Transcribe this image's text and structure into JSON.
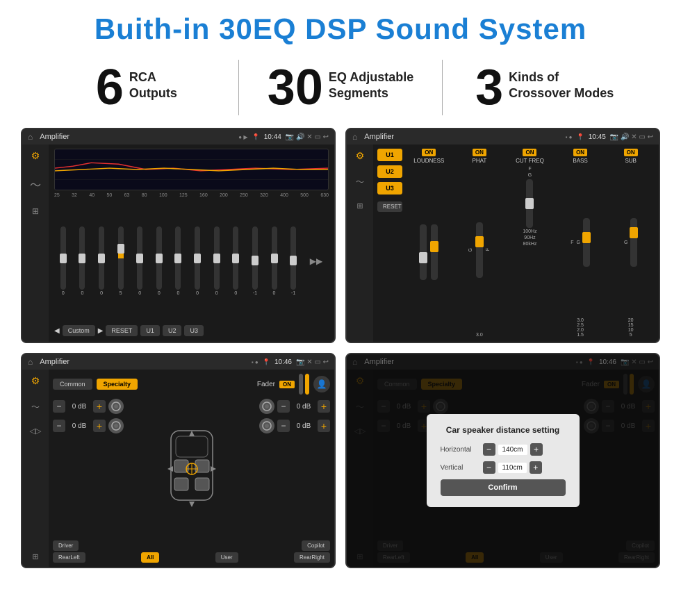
{
  "header": {
    "title": "Buith-in 30EQ DSP Sound System"
  },
  "stats": [
    {
      "number": "6",
      "label_line1": "RCA",
      "label_line2": "Outputs"
    },
    {
      "number": "30",
      "label_line1": "EQ Adjustable",
      "label_line2": "Segments"
    },
    {
      "number": "3",
      "label_line1": "Kinds of",
      "label_line2": "Crossover Modes"
    }
  ],
  "screens": {
    "screen1": {
      "status_title": "Amplifier",
      "status_time": "10:44",
      "freq_labels": [
        "25",
        "32",
        "40",
        "50",
        "63",
        "80",
        "100",
        "125",
        "160",
        "200",
        "250",
        "320",
        "400",
        "500",
        "630"
      ],
      "slider_values": [
        "0",
        "0",
        "0",
        "5",
        "0",
        "0",
        "0",
        "0",
        "0",
        "0",
        "-1",
        "0",
        "-1"
      ],
      "bottom_btns": [
        "Custom",
        "RESET",
        "U1",
        "U2",
        "U3"
      ]
    },
    "screen2": {
      "status_title": "Amplifier",
      "status_time": "10:45",
      "presets": [
        "U1",
        "U2",
        "U3"
      ],
      "controls": [
        {
          "label": "LOUDNESS",
          "on": true
        },
        {
          "label": "PHAT",
          "on": true
        },
        {
          "label": "CUT FREQ",
          "on": true
        },
        {
          "label": "BASS",
          "on": true
        },
        {
          "label": "SUB",
          "on": true
        }
      ],
      "reset_label": "RESET"
    },
    "screen3": {
      "status_title": "Amplifier",
      "status_time": "10:46",
      "tabs": [
        "Common",
        "Specialty"
      ],
      "fader_label": "Fader",
      "fader_on": "ON",
      "db_values": [
        "0 dB",
        "0 dB",
        "0 dB",
        "0 dB"
      ],
      "bottom_labels": [
        "Driver",
        "",
        "Copilot",
        "RearLeft",
        "All",
        "User",
        "RearRight"
      ]
    },
    "screen4": {
      "status_title": "Amplifier",
      "status_time": "10:46",
      "tabs": [
        "Common",
        "Specialty"
      ],
      "dialog": {
        "title": "Car speaker distance setting",
        "horizontal_label": "Horizontal",
        "horizontal_value": "140cm",
        "vertical_label": "Vertical",
        "vertical_value": "110cm",
        "confirm_label": "Confirm"
      },
      "bottom_labels": [
        "Driver",
        "",
        "Copilot",
        "RearLeft",
        "All",
        "User",
        "RearRight"
      ]
    }
  },
  "icons": {
    "home": "⌂",
    "pin": "📍",
    "speaker": "🔊",
    "settings": "⚙",
    "back": "↩",
    "equalizer": "≡",
    "waveform": "〜",
    "arrows": "◁▷",
    "chevron_down": "▼",
    "chevron_up": "▲",
    "chevron_left": "◀",
    "chevron_right": "▶",
    "user": "👤",
    "camera": "📷"
  }
}
